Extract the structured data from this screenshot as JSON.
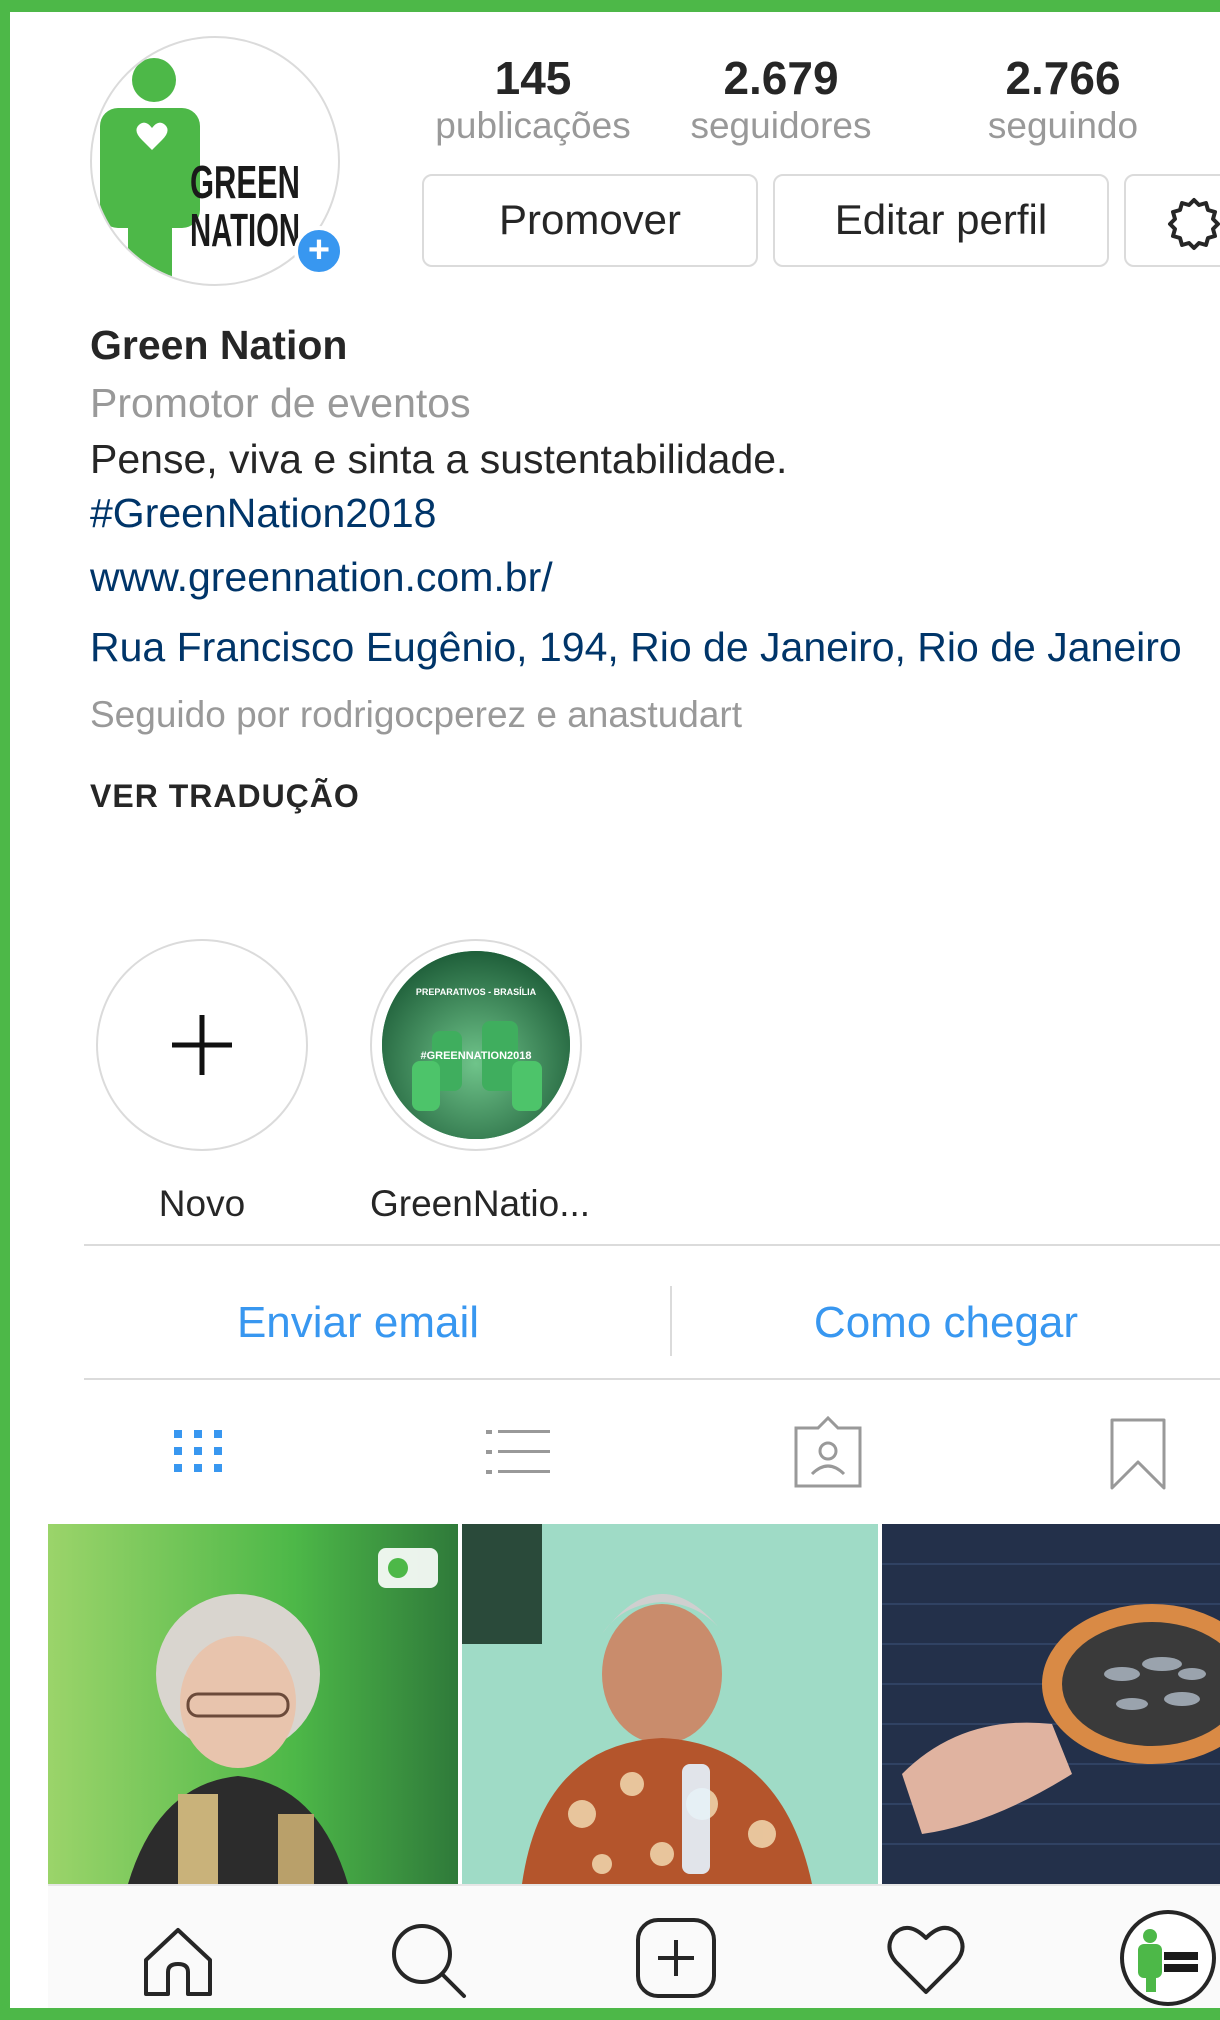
{
  "profile": {
    "avatar_logo_text": [
      "GREEN",
      "NATION"
    ],
    "name": "Green Nation",
    "category": "Promotor de eventos",
    "bio": "Pense, viva e sinta a sustentabilidade.",
    "hashtag": "#GreenNation2018",
    "website": "www.greennation.com.br/",
    "address": "Rua Francisco Eugênio, 194, Rio de Janeiro, Rio de Janeiro",
    "followed_by": "Seguido por rodrigocperez e anastudart",
    "translate": "VER TRADUÇÃO"
  },
  "stats": {
    "posts": {
      "value": "145",
      "label": "publicações"
    },
    "followers": {
      "value": "2.679",
      "label": "seguidores"
    },
    "following": {
      "value": "2.766",
      "label": "seguindo"
    }
  },
  "buttons": {
    "promote": "Promover",
    "edit_profile": "Editar perfil",
    "settings_icon": "gear-icon"
  },
  "highlights": [
    {
      "label": "Novo",
      "icon": "plus-icon"
    },
    {
      "label": "GreenNatio...",
      "cover_text_top": "PREPARATIVOS - BRASÍLIA",
      "cover_text_mid": "#GREENNATION2018"
    }
  ],
  "contact": {
    "email": "Enviar email",
    "directions": "Como chegar"
  },
  "tabs": [
    "grid-icon",
    "list-icon",
    "tagged-icon",
    "bookmark-icon"
  ],
  "colors": {
    "brand_green": "#4db848",
    "link_blue": "#3897f0",
    "dark_link": "#003569",
    "muted": "#999999",
    "border": "#dbdbdb"
  },
  "bottom_nav": [
    "home-icon",
    "search-icon",
    "add-post-icon",
    "heart-icon",
    "profile-avatar"
  ]
}
